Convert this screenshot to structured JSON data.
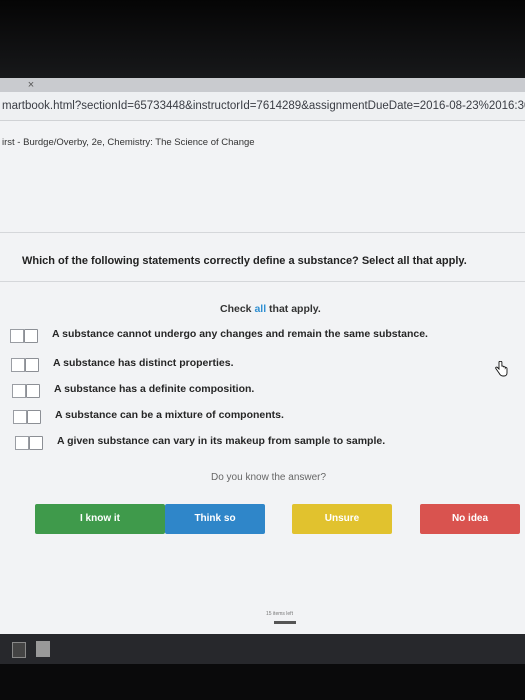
{
  "browser": {
    "tab_close_glyph": "×",
    "url": "martbook.html?sectionId=65733448&instructorId=7614289&assignmentDueDate=2016-08-23%2016:30"
  },
  "course": {
    "title": "irst - Burdge/Overby, 2e, Chemistry: The Science of Change"
  },
  "question": {
    "text": "Which of the following statements correctly define a substance? Select all that apply.",
    "check_hint_prefix": "Check ",
    "check_hint_all": "all",
    "check_hint_suffix": " that apply.",
    "options": [
      "A substance cannot undergo any changes and remain the same substance.",
      "A substance has distinct properties.",
      "A substance has a definite composition.",
      "A substance can be a mixture of components.",
      "A given substance can vary in its makeup from sample to sample."
    ]
  },
  "confidence": {
    "prompt": "Do you know the answer?",
    "buttons": {
      "know": "I know it",
      "think": "Think so",
      "unsure": "Unsure",
      "no_idea": "No idea"
    }
  },
  "progress": {
    "items_left": "15 items left"
  },
  "colors": {
    "know": "#3f9a4b",
    "think": "#2f86c9",
    "unsure": "#e1c22e",
    "no_idea": "#d9534f",
    "link_blue": "#2f8fd1"
  },
  "icons": {
    "cursor": "hand-pointer-icon",
    "taskbar_app": "document-icon"
  }
}
